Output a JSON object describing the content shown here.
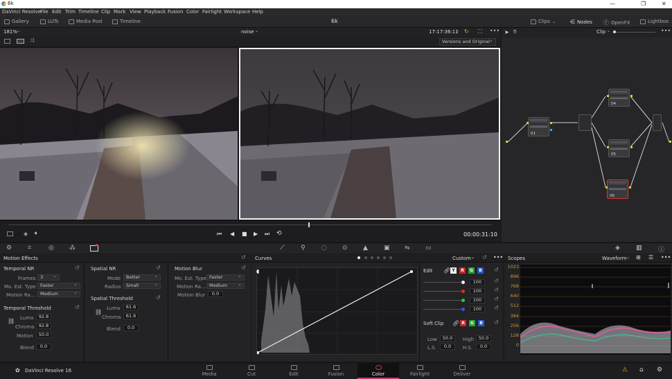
{
  "window": {
    "title": "6k"
  },
  "menu": [
    "DaVinci Resolve",
    "File",
    "Edit",
    "Trim",
    "Timeline",
    "Clip",
    "Mark",
    "View",
    "Playback",
    "Fusion",
    "Color",
    "Fairlight",
    "Workspace",
    "Help"
  ],
  "toolbar": {
    "gallery": "Gallery",
    "luts": "LUTs",
    "media_pool": "Media Pool",
    "timeline": "Timeline",
    "project": "6k",
    "clips": "Clips",
    "nodes": "Nodes",
    "openfx": "OpenFX",
    "lightbox": "Lightbox"
  },
  "viewer": {
    "zoom": "181%",
    "clip_name": "noise",
    "timecode_top": "17:17:36:11",
    "compare_mode": "Versions and Original",
    "timecode": "00:00:31:10"
  },
  "node_editor": {
    "mode": "Clip",
    "nodes": [
      "01",
      "04",
      "05",
      "06"
    ]
  },
  "motion_effects": {
    "title": "Motion Effects",
    "temporal_nr": {
      "title": "Temporal NR",
      "frames_label": "Frames",
      "frames": "3",
      "mo_est_label": "Mo. Est. Type",
      "mo_est": "Faster",
      "motion_range_label": "Motion Ra...",
      "motion_range": "Medium"
    },
    "temporal_threshold": {
      "title": "Temporal Threshold",
      "luma_label": "Luma",
      "luma": "92.8",
      "chroma_label": "Chroma",
      "chroma": "92.8",
      "motion_label": "Motion",
      "motion": "50.0",
      "blend_label": "Blend",
      "blend": "0.0"
    },
    "spatial_nr": {
      "title": "Spatial NR",
      "mode_label": "Mode",
      "mode": "Better",
      "radius_label": "Radius",
      "radius": "Small"
    },
    "spatial_threshold": {
      "title": "Spatial Threshold",
      "luma_label": "Luma",
      "luma": "61.6",
      "chroma_label": "Chroma",
      "chroma": "61.6",
      "blend_label": "Blend",
      "blend": "0.0"
    },
    "motion_blur": {
      "title": "Motion Blur",
      "mo_est_label": "Mo. Est. Type",
      "mo_est": "Faster",
      "motion_range_label": "Motion Ra...",
      "motion_range": "Medium",
      "blur_label": "Motion Blur",
      "blur": "0.0"
    }
  },
  "curves": {
    "title": "Curves",
    "preset": "Custom",
    "edit_label": "Edit",
    "channel_values": [
      "100",
      "100",
      "100",
      "100"
    ],
    "soft_clip_label": "Soft Clip",
    "low_label": "Low",
    "low": "50.0",
    "high_label": "High",
    "high": "50.0",
    "ls_label": "L.S.",
    "ls": "0.0",
    "hs_label": "H.S.",
    "hs": "0.0"
  },
  "scopes": {
    "title": "Scopes",
    "mode": "Waveform",
    "scale": [
      "1023",
      "896",
      "768",
      "640",
      "512",
      "384",
      "256",
      "128",
      "0"
    ]
  },
  "footer": {
    "app_name": "DaVinci Resolve 16",
    "pages": [
      "Media",
      "Cut",
      "Edit",
      "Fusion",
      "Color",
      "Fairlight",
      "Deliver"
    ],
    "active_page": "Color"
  },
  "colors": {
    "active": "#c83a6a",
    "node_green": "#b8e02a",
    "node_cyan": "#2ab8e0"
  }
}
